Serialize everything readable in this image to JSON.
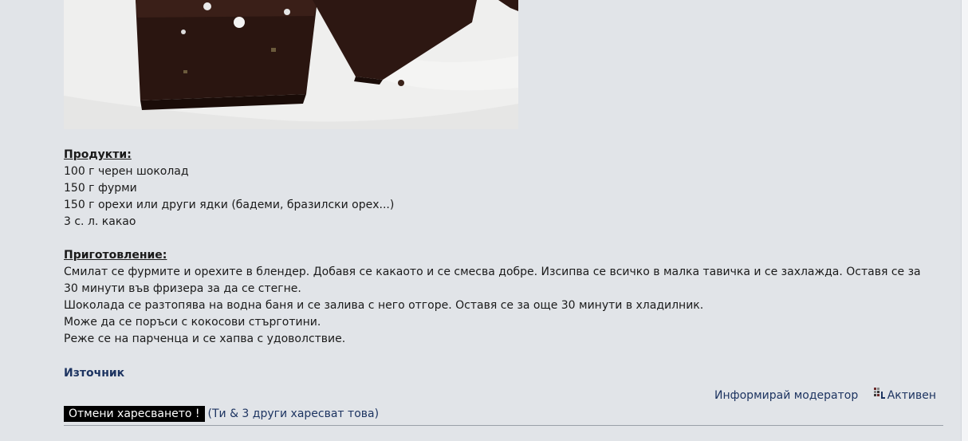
{
  "recipe": {
    "products_heading": "Продукти:",
    "ingredients": [
      "100 г черен шоколад",
      "150 г фурми",
      "150 г орехи или други ядки (бадеми, бразилски орех...)",
      "3 с. л. какао"
    ],
    "preparation_heading": "Приготовление:",
    "steps": [
      "Смилат се фурмите и орехите в блендер. Добавя се какаото и се смесва добре. Изсипва се всичко в малка тавичка и се захлажда. Оставя се за 30 минути във фризера за да се стегне.",
      "Шоколада се разтопява на водна баня и се залива с него отгоре. Оставя се за още 30 минути в хладилник.",
      "Може да се поръси с кокосови стърготини.",
      "Реже се на парченца и се хапва с удоволствие."
    ],
    "source_label": "Източник"
  },
  "footer": {
    "report_label": "Информирай модератор",
    "status_label": "Активен",
    "status_icon": "user-status-icon"
  },
  "likes": {
    "unlike_label": "Отмени харесването !",
    "likes_text": "(Ти & 3 други харесват това)"
  },
  "colors": {
    "panel_bg": "#e1e4e8",
    "link": "#1d3461",
    "button_bg": "#000000"
  }
}
